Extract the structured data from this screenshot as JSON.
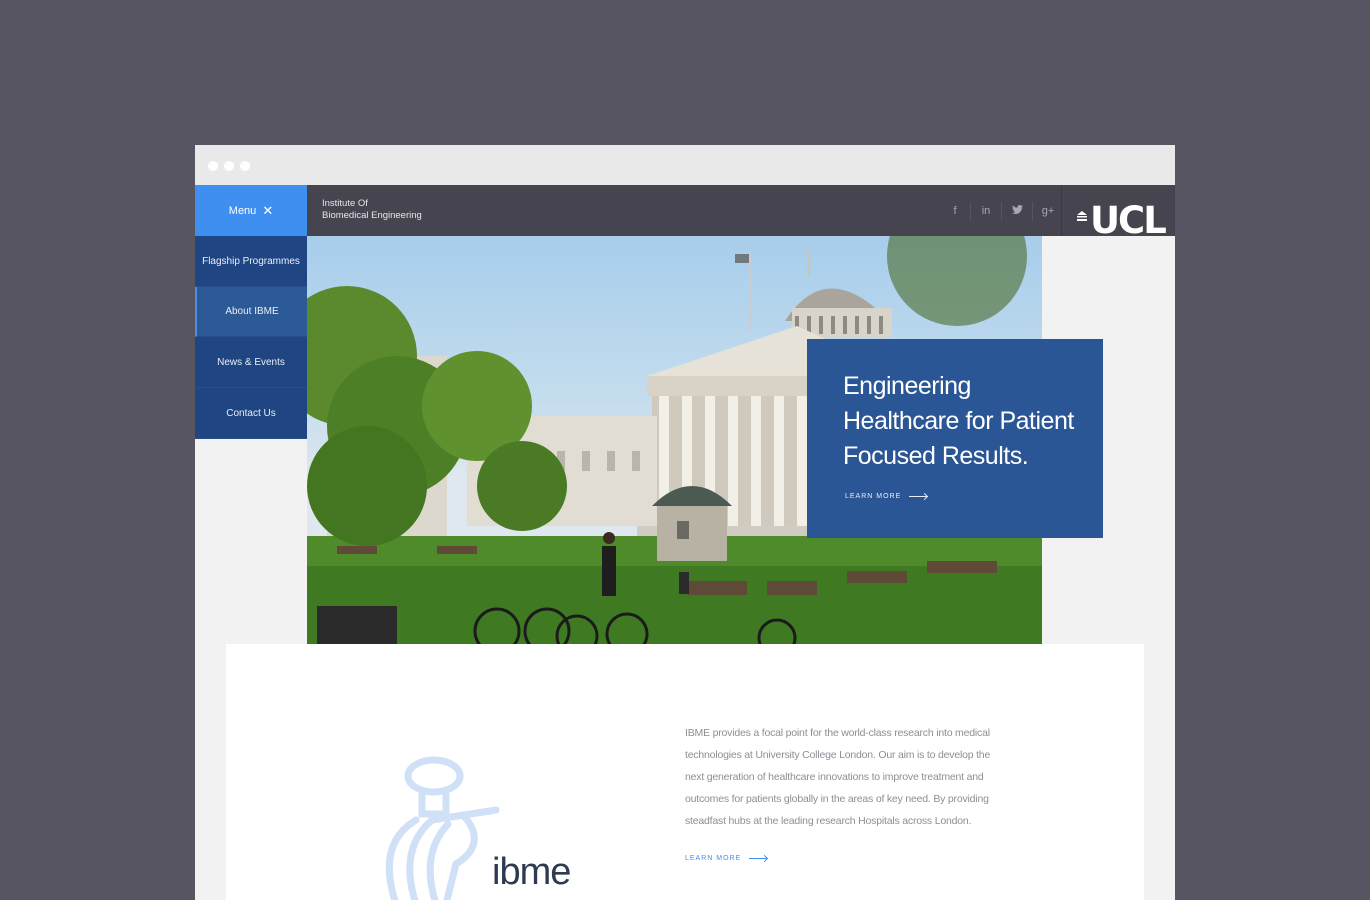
{
  "header": {
    "menu_label": "Menu",
    "site_title_line1": "Institute Of",
    "site_title_line2": "Biomedical Engineering",
    "social": [
      {
        "icon": "facebook-icon",
        "glyph": "f"
      },
      {
        "icon": "linkedin-icon",
        "glyph": "in"
      },
      {
        "icon": "twitter-icon",
        "glyph": "🐦"
      },
      {
        "icon": "google-plus-icon",
        "glyph": "g+"
      }
    ],
    "logo_text": "UCL"
  },
  "nav": {
    "items": [
      {
        "label": "Flagship Programmes"
      },
      {
        "label": "About IBME"
      },
      {
        "label": "News & Events"
      },
      {
        "label": "Contact Us"
      }
    ]
  },
  "hero": {
    "headline": "Engineering Healthcare for Patient Focused Results.",
    "cta": "LEARN MORE"
  },
  "about": {
    "text": "IBME provides a focal point for the world-class research into medical technologies at University College London. Our aim is to develop the next generation of healthcare innovations to improve treatment and outcomes for patients globally in the areas of key need. By providing steadfast hubs at the leading research Hospitals across London.",
    "cta": "LEARN MORE",
    "logo_word": "ibme"
  },
  "colors": {
    "accent": "#3f8ff0",
    "navy": "#1f4682",
    "callout": "#2a5696",
    "topbar": "#46444f"
  }
}
